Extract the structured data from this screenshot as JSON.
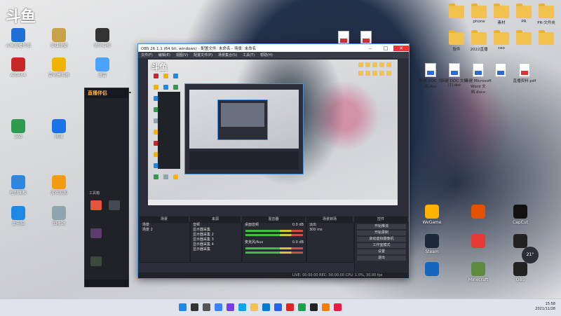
{
  "desktop": {
    "logo": "斗鱼",
    "left_icons": [
      {
        "label": "斗鱼直播伴侣",
        "color": "#1f6fd6"
      },
      {
        "label": "英雄联盟",
        "color": "#c8a24a"
      },
      {
        "label": "使命召唤",
        "color": "#333333"
      },
      {
        "label": "AIDA64",
        "color": "#c62828"
      },
      {
        "label": "雷电模拟器",
        "color": "#f0b400"
      },
      {
        "label": "迅雷",
        "color": "#4aa3ff"
      },
      {
        "label": "360",
        "color": "#2e9b4e"
      },
      {
        "label": "腾讯",
        "color": "#1a73e8"
      },
      {
        "label": "控制面板",
        "color": "#2e86de"
      },
      {
        "label": "游戏加加",
        "color": "#f39c12"
      },
      {
        "label": "此电脑",
        "color": "#1e88e5"
      },
      {
        "label": "回收站",
        "color": "#90a4ae"
      }
    ],
    "right_folders": [
      "",
      "phone",
      "素材",
      "PR",
      "PR-文件夹",
      "软件",
      "2022直播",
      "ceo",
      "",
      ""
    ],
    "right_docs": [
      "新建 DOC 文档.doc",
      "新建 DOC 文档(1).doc",
      "新建 Microsoft Word 文档.docx",
      "",
      "直播资料.pdf"
    ],
    "right_icons": [
      {
        "label": "WeGame",
        "color": "#ffb300"
      },
      {
        "label": "",
        "color": "#e65100"
      },
      {
        "label": "CapCut",
        "color": "#111111"
      },
      {
        "label": "Steam",
        "color": "#1b2838"
      },
      {
        "label": "",
        "color": "#e53935"
      },
      {
        "label": "",
        "color": "#222222"
      },
      {
        "label": "",
        "color": "#1565c0"
      },
      {
        "label": "Minecraft",
        "color": "#5d8a3c"
      },
      {
        "label": "OBS",
        "color": "#222222"
      }
    ]
  },
  "live_app": {
    "title": "直播伴侣",
    "badge": "",
    "side_items": [
      "工具箱",
      "直播间",
      "弹幕",
      "礼物",
      "设置"
    ]
  },
  "obs": {
    "window_title": "OBS 26.1.1 (64 bit, windows) - 配置文件: 未命名 - 场景: 未命名",
    "menu": [
      "文件(F)",
      "编辑(E)",
      "视图(V)",
      "配置文件(P)",
      "场景集合(S)",
      "工具(T)",
      "帮助(H)"
    ],
    "docks": {
      "scenes_label": "场景",
      "sources_label": "来源",
      "mixer_label": "混音器",
      "transitions_label": "场景转场",
      "controls_label": "控件"
    },
    "scenes": [
      "场景",
      "场景 2"
    ],
    "sources": [
      "音频",
      "显示器采集",
      "显示器采集 2",
      "显示器采集 3",
      "显示器采集 4",
      "显示器采集"
    ],
    "mixer": [
      {
        "name": "桌面音频",
        "db": "0.0 dB"
      },
      {
        "name": "麦克风/Aux",
        "db": "0.0 dB"
      }
    ],
    "transition": {
      "type": "淡出",
      "duration": "300 ms"
    },
    "controls": [
      "开始推流",
      "开始录制",
      "启动虚拟摄像机",
      "工作室模式",
      "设置",
      "退出"
    ],
    "status": "LIVE: 00:00:00  REC: 00:00:00  CPU: 1.0%, 30.00 fps"
  },
  "taskbar": {
    "icons": [
      "start",
      "search",
      "taskview",
      "widgets",
      "chat",
      "edge",
      "explorer",
      "store",
      "mail",
      "wps",
      "chrome",
      "obs",
      "douyu",
      "live"
    ],
    "colors": [
      "#1e88e5",
      "#333333",
      "#555555",
      "#3b82f6",
      "#7c3aed",
      "#0ea5e9",
      "#f2c14e",
      "#0078d4",
      "#2563eb",
      "#dc2626",
      "#16a34a",
      "#222222",
      "#ff7a00",
      "#e11d48"
    ],
    "time": "15:58",
    "date": "2021/11/28"
  },
  "weather_bubble": "21°"
}
